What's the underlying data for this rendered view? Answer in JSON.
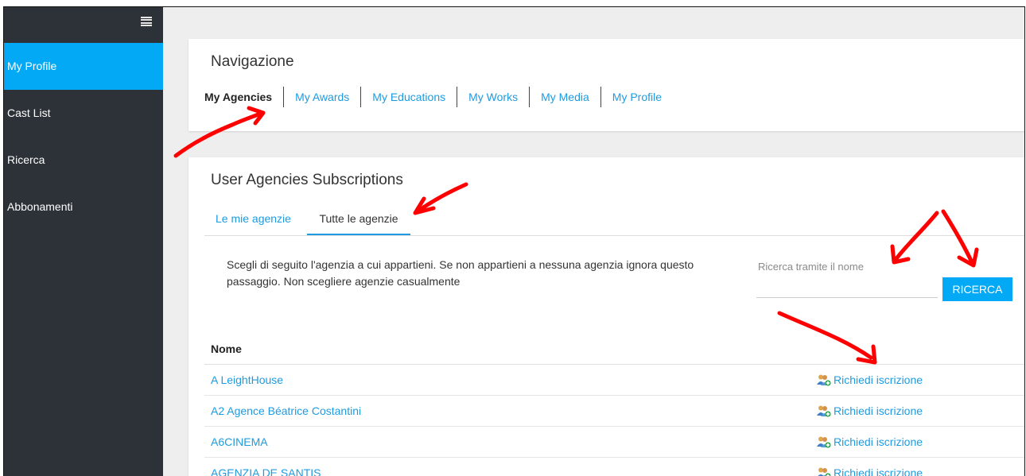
{
  "sidebar": {
    "items": [
      {
        "label": "My Profile",
        "active": true
      },
      {
        "label": "Cast List",
        "active": false
      },
      {
        "label": "Ricerca",
        "active": false
      },
      {
        "label": "Abbonamenti",
        "active": false
      }
    ]
  },
  "nav_card": {
    "title": "Navigazione",
    "tabs": [
      "My Agencies",
      "My Awards",
      "My Educations",
      "My Works",
      "My Media",
      "My Profile"
    ],
    "active_tab": "My Agencies"
  },
  "subs_card": {
    "title": "User Agencies Subscriptions",
    "tabs": [
      "Le mie agenzie",
      "Tutte le agenzie"
    ],
    "active_tab": "Tutte le agenzie",
    "info_text": "Scegli di seguito l'agenzia a cui appartieni. Se non appartieni a nessuna agenzia ignora questo passaggio. Non scegliere agenzie casualmente",
    "search": {
      "placeholder": "Ricerca tramite il nome",
      "value": "",
      "button_label": "RICERCA"
    },
    "table": {
      "header": "Nome",
      "rows": [
        {
          "name": "A LeightHouse",
          "action": "Richiedi iscrizione"
        },
        {
          "name": "A2 Agence Béatrice Costantini",
          "action": "Richiedi iscrizione"
        },
        {
          "name": "A6CINEMA",
          "action": "Richiedi iscrizione"
        },
        {
          "name": "AGENZIA DE SANTIS",
          "action": "Richiedi iscrizione"
        }
      ]
    }
  },
  "colors": {
    "accent": "#03a9f4",
    "link": "#1e9be0",
    "sidebar_bg": "#2d3238",
    "annotation": "#ff0000"
  },
  "icons": {
    "menu": "hamburger-icon",
    "subscribe": "add-user-icon"
  }
}
